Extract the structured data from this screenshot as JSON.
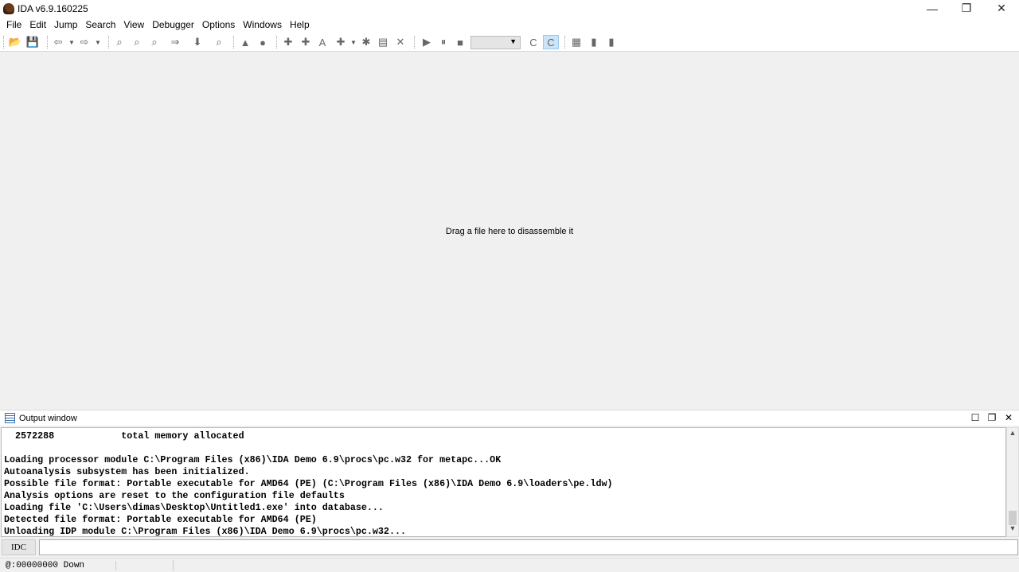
{
  "window": {
    "title": "IDA v6.9.160225",
    "minimize": "—",
    "restore": "❐",
    "close": "✕"
  },
  "menu": [
    "File",
    "Edit",
    "Jump",
    "Search",
    "View",
    "Debugger",
    "Options",
    "Windows",
    "Help"
  ],
  "toolbar": {
    "icons": [
      {
        "name": "open-file-icon",
        "glyph": "📂"
      },
      {
        "name": "save-icon",
        "glyph": "💾"
      },
      {
        "name": "back-arrow-icon",
        "glyph": "⇦"
      },
      {
        "name": "forward-arrow-icon",
        "glyph": "⇨"
      },
      {
        "name": "search-hex-icon",
        "glyph": "⌕"
      },
      {
        "name": "search-text-icon",
        "glyph": "⌕"
      },
      {
        "name": "search-immediate-icon",
        "glyph": "⌕"
      },
      {
        "name": "search-next-icon",
        "glyph": "⇒"
      },
      {
        "name": "jump-down-icon",
        "glyph": "⬇"
      },
      {
        "name": "search-seq-icon",
        "glyph": "⌕"
      },
      {
        "name": "graph-icon",
        "glyph": "▲"
      },
      {
        "name": "circle-icon",
        "glyph": "●"
      },
      {
        "name": "create-code-icon",
        "glyph": "✚"
      },
      {
        "name": "create-data-icon",
        "glyph": "✚"
      },
      {
        "name": "create-string-icon",
        "glyph": "A"
      },
      {
        "name": "add-struct-icon",
        "glyph": "✚"
      },
      {
        "name": "add-function-icon",
        "glyph": "✱"
      },
      {
        "name": "patch-icon",
        "glyph": "▤"
      },
      {
        "name": "delete-icon",
        "glyph": "✕"
      },
      {
        "name": "play-icon",
        "glyph": "▶"
      },
      {
        "name": "pause-icon",
        "glyph": "⏸"
      },
      {
        "name": "stop-icon",
        "glyph": "■"
      },
      {
        "name": "attach-icon",
        "glyph": "C"
      },
      {
        "name": "run-to-cursor-icon",
        "glyph": "C"
      },
      {
        "name": "breakpoint-list-icon",
        "glyph": "▦"
      },
      {
        "name": "add-breakpoint-icon",
        "glyph": "▮"
      },
      {
        "name": "delete-breakpoint-icon",
        "glyph": "▮"
      }
    ],
    "debugger_select": ""
  },
  "main": {
    "hint": "Drag a file here to disassemble it"
  },
  "output": {
    "title": "Output window",
    "lines": [
      "  2572288            total memory allocated",
      "",
      "Loading processor module C:\\Program Files (x86)\\IDA Demo 6.9\\procs\\pc.w32 for metapc...OK",
      "Autoanalysis subsystem has been initialized.",
      "Possible file format: Portable executable for AMD64 (PE) (C:\\Program Files (x86)\\IDA Demo 6.9\\loaders\\pe.ldw)",
      "Analysis options are reset to the configuration file defaults",
      "Loading file 'C:\\Users\\dimas\\Desktop\\Untitled1.exe' into database...",
      "Detected file format: Portable executable for AMD64 (PE)",
      "Unloading IDP module C:\\Program Files (x86)\\IDA Demo 6.9\\procs\\pc.w32..."
    ]
  },
  "command": {
    "button": "IDC",
    "value": ""
  },
  "status": {
    "text": "@:00000000 Down"
  }
}
